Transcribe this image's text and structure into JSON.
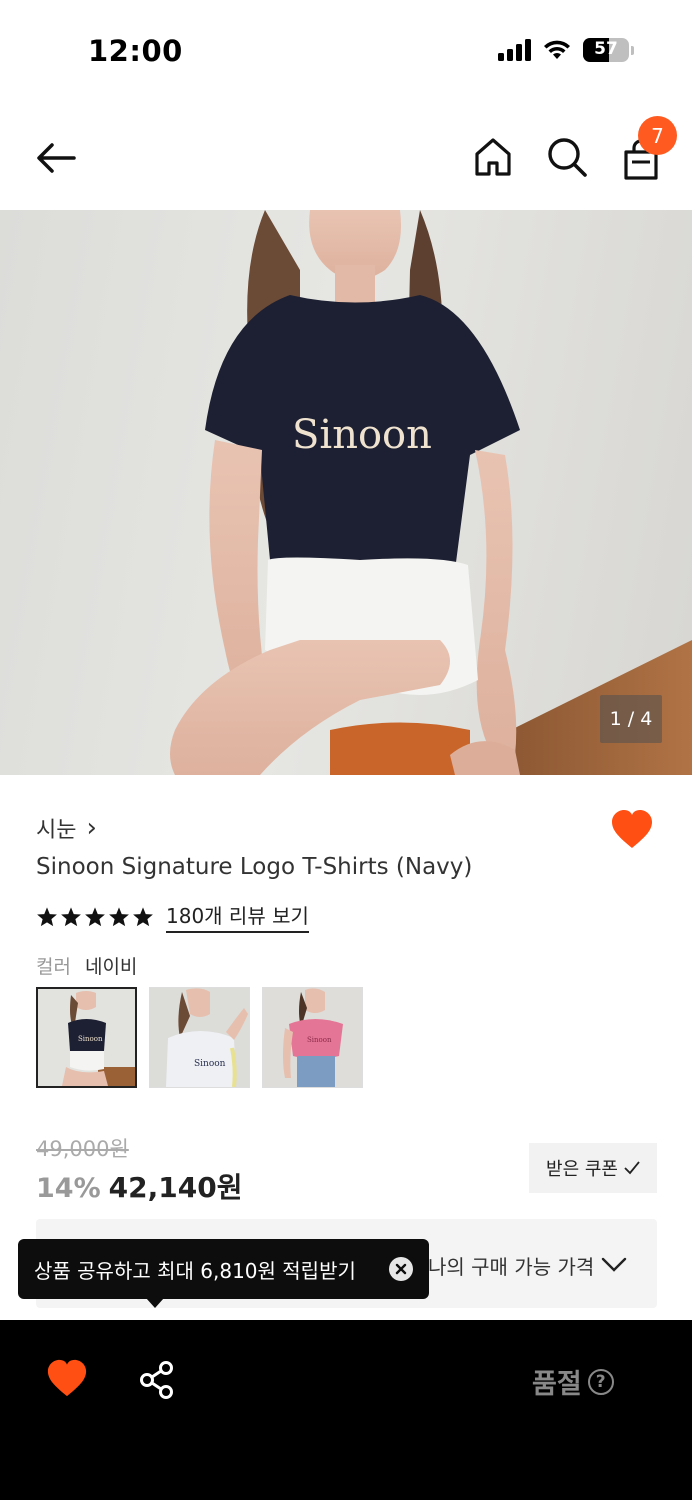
{
  "status_bar": {
    "time": "12:00",
    "battery": "57",
    "battery_level_percent": 57
  },
  "nav": {
    "cart_count": "7"
  },
  "gallery": {
    "page_indicator": "1 / 4",
    "shirt_print": "Sinoon"
  },
  "product": {
    "brand": "시눈",
    "brand_chevron": "›",
    "title": "Sinoon Signature Logo T-Shirts (Navy)",
    "rating_stars": 5,
    "review_link": "180개 리뷰 보기",
    "color_label": "컬러",
    "color_value": "네이비",
    "swatches": [
      {
        "name": "navy",
        "print": "Sinoon"
      },
      {
        "name": "white",
        "print": "Sinoon"
      },
      {
        "name": "pink",
        "print": "Sinoon"
      }
    ]
  },
  "price": {
    "original": "49,000원",
    "discount": "14%",
    "sale": "42,140원",
    "coupon_button": "받은 쿠폰",
    "my_price_label": "나의 구매 가능 가격"
  },
  "tooltip": {
    "text": "상품 공유하고 최대 6,810원 적립받기"
  },
  "bottom_bar": {
    "soldout": "품절",
    "help": "?"
  },
  "colors": {
    "accent": "#ff5a1f",
    "heart": "#ff4f12",
    "navy": "#1d2032",
    "text": "#222222"
  }
}
